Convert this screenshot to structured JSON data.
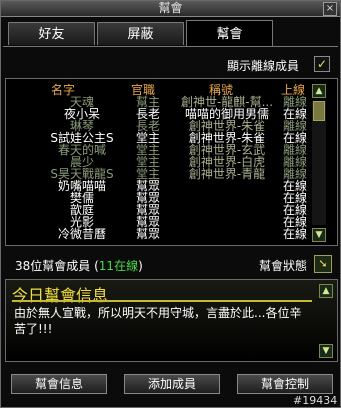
{
  "window": {
    "title": "幫會"
  },
  "tabs": [
    {
      "label": "好友"
    },
    {
      "label": "屏蔽"
    },
    {
      "label": "幫會"
    }
  ],
  "offline_toggle": {
    "label": "顯示離線成員",
    "checked": "✓"
  },
  "table": {
    "headers": {
      "name": "名字",
      "rank": "官職",
      "title": "稱號",
      "status": "上線"
    },
    "rows": [
      {
        "name": "天魂",
        "rank": "幫主",
        "title": "創神世-龍麒-幫...",
        "status": "離線",
        "online": false
      },
      {
        "name": "夜小呆",
        "rank": "長老",
        "title": "喵喵的御用男儒",
        "status": "在線",
        "online": true
      },
      {
        "name": "琳琴",
        "rank": "長老",
        "title": "創神世界-朱雀",
        "status": "離線",
        "online": false
      },
      {
        "name": "S試娃公主S",
        "rank": "堂主",
        "title": "創神世界-朱雀",
        "status": "在線",
        "online": true
      },
      {
        "name": "春天的喊",
        "rank": "堂主",
        "title": "創神世界-玄武",
        "status": "離線",
        "online": false
      },
      {
        "name": "晨少",
        "rank": "堂主",
        "title": "創神世界-白虎",
        "status": "離線",
        "online": false
      },
      {
        "name": "S昊天戰龍S",
        "rank": "堂主",
        "title": "創神世界-青龍",
        "status": "離線",
        "online": false
      },
      {
        "name": "奶嘴喵喵",
        "rank": "幫眾",
        "title": "",
        "status": "在線",
        "online": true
      },
      {
        "name": "樊儒",
        "rank": "幫眾",
        "title": "",
        "status": "在線",
        "online": true
      },
      {
        "name": "歆庭",
        "rank": "幫眾",
        "title": "",
        "status": "在線",
        "online": true
      },
      {
        "name": "光影",
        "rank": "幫眾",
        "title": "",
        "status": "在線",
        "online": true
      },
      {
        "name": "冷微昔曆",
        "rank": "幫眾",
        "title": "",
        "status": "在線",
        "online": true
      }
    ]
  },
  "summary": {
    "count_text": "38位幫會成員",
    "open_paren": " (",
    "online_count": "11",
    "online_word": "在線",
    "close_paren": ")"
  },
  "guild_status": {
    "label": "幫會狀態"
  },
  "daily_message": {
    "header": "今日幫會信息",
    "text": "由於無人宣戰，所以明天不用守城，言盡於此...各位辛苦了!!!"
  },
  "buttons": {
    "info": "幫會信息",
    "add": "添加成員",
    "control": "幫會控制"
  },
  "footer_id": "#19434",
  "colors": {
    "online": "#ffffff",
    "offline": "#8a9a7a",
    "offline_title": "#a8b090",
    "online_title": "#ffffff",
    "accent_gold": "#e8a84a",
    "count_green": "#4ad84a"
  }
}
